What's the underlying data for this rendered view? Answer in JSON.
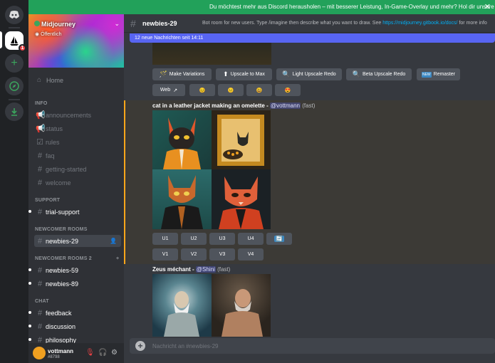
{
  "banner": {
    "text": "Du möchtest mehr aus Discord herausholen – mit besserer Leistung, In-Game-Overlay und mehr? Hol dir unsere Desktop-A",
    "close_icon": "close-icon"
  },
  "rail": {
    "home_icon": "discord-logo-icon",
    "badge": "1",
    "add_icon": "plus-icon",
    "explore_icon": "compass-icon",
    "download_icon": "download-icon"
  },
  "server": {
    "name": "Midjourney",
    "visibility": "Öffentlich"
  },
  "sidebar": {
    "home": "Home",
    "categories": [
      {
        "label": "INFO"
      },
      {
        "label": "SUPPORT"
      },
      {
        "label": "NEWCOMER ROOMS"
      },
      {
        "label": "NEWCOMER ROOMS 2"
      },
      {
        "label": "CHAT"
      }
    ],
    "channels": [
      {
        "label": "announcements"
      },
      {
        "label": "status"
      },
      {
        "label": "rules"
      },
      {
        "label": "faq"
      },
      {
        "label": "getting-started"
      },
      {
        "label": "welcome"
      },
      {
        "label": "trial-support"
      },
      {
        "label": "newbies-29"
      },
      {
        "label": "newbies-59"
      },
      {
        "label": "newbies-89"
      },
      {
        "label": "feedback"
      },
      {
        "label": "discussion"
      },
      {
        "label": "philosophy"
      }
    ]
  },
  "user": {
    "name": "vottmann",
    "tag": "#8798"
  },
  "header": {
    "channel": "newbies-29",
    "topic_pre": "Bot room for new users. Type /imagine then describe what you want to draw. See ",
    "topic_link": "https://midjourney.gitbook.io/docs/",
    "topic_post": " for more info"
  },
  "new_messages": "12 neue Nachrichten seit 14:11",
  "message1": {
    "buttons": [
      "Make Variations",
      "Upscale to Max",
      "Light Upscale Redo",
      "Beta Upscale Redo",
      "Remaster"
    ],
    "web_label": "Web",
    "reactions": [
      "😣",
      "😐",
      "😃",
      "😍"
    ]
  },
  "message2": {
    "prompt": "cat in a leather jacket making an omelette",
    "sep": " - ",
    "mention": "@vottmann",
    "speed": "(fast)",
    "u_buttons": [
      "U1",
      "U2",
      "U3",
      "U4"
    ],
    "v_buttons": [
      "V1",
      "V2",
      "V3",
      "V4"
    ],
    "refresh_icon": "refresh-icon"
  },
  "message3": {
    "prompt": "Zeus méchant",
    "sep": " - ",
    "mention": "@Shini",
    "speed": "(fast)"
  },
  "input": {
    "placeholder": "Nachricht an #newbies-29"
  }
}
